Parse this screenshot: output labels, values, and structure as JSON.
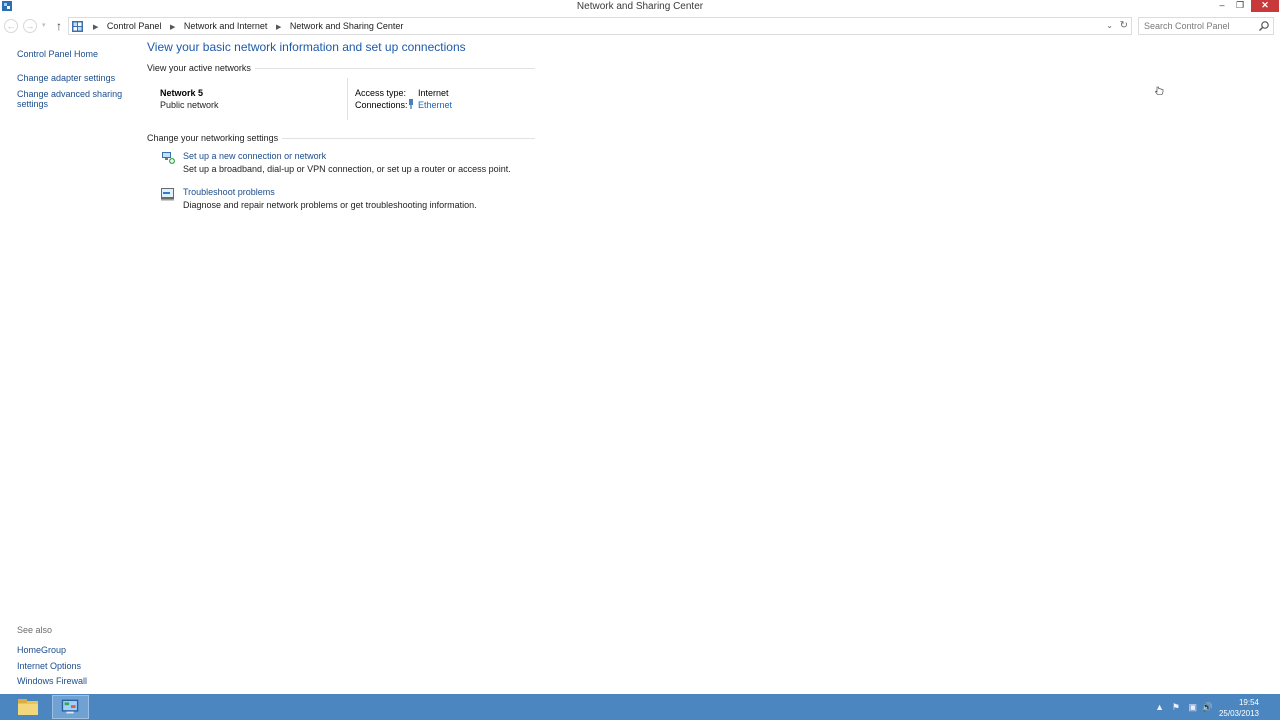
{
  "window": {
    "title": "Network and Sharing Center"
  },
  "address": {
    "crumbs": [
      "Control Panel",
      "Network and Internet",
      "Network and Sharing Center"
    ],
    "search_placeholder": "Search Control Panel"
  },
  "left_pane": {
    "links": [
      "Control Panel Home",
      "Change adapter settings",
      "Change advanced sharing settings"
    ],
    "see_also": {
      "header": "See also",
      "links": [
        "HomeGroup",
        "Internet Options",
        "Windows Firewall"
      ]
    }
  },
  "main": {
    "heading": "View your basic network information and set up connections",
    "active_networks_header": "View your active networks",
    "network": {
      "name": "Network  5",
      "category": "Public network",
      "access_type_label": "Access type:",
      "access_type_value": "Internet",
      "connections_label": "Connections:",
      "connection_name": "Ethernet"
    },
    "change_settings_header": "Change your networking settings",
    "tasks": [
      {
        "title": "Set up a new connection or network",
        "description": "Set up a broadband, dial-up or VPN connection, or set up a router or access point.",
        "icon": "network-setup-icon"
      },
      {
        "title": "Troubleshoot problems",
        "description": "Diagnose and repair network problems or get troubleshooting information.",
        "icon": "troubleshoot-icon"
      }
    ]
  },
  "taskbar": {
    "pinned": [
      "file-explorer-icon",
      "control-panel-icon"
    ],
    "time": "19:54",
    "date": "25/03/2013"
  },
  "colors": {
    "accent": "#1e5aa8",
    "link": "#1c4d8c",
    "taskbar": "#4b86c0",
    "close_button": "#c7393a"
  }
}
